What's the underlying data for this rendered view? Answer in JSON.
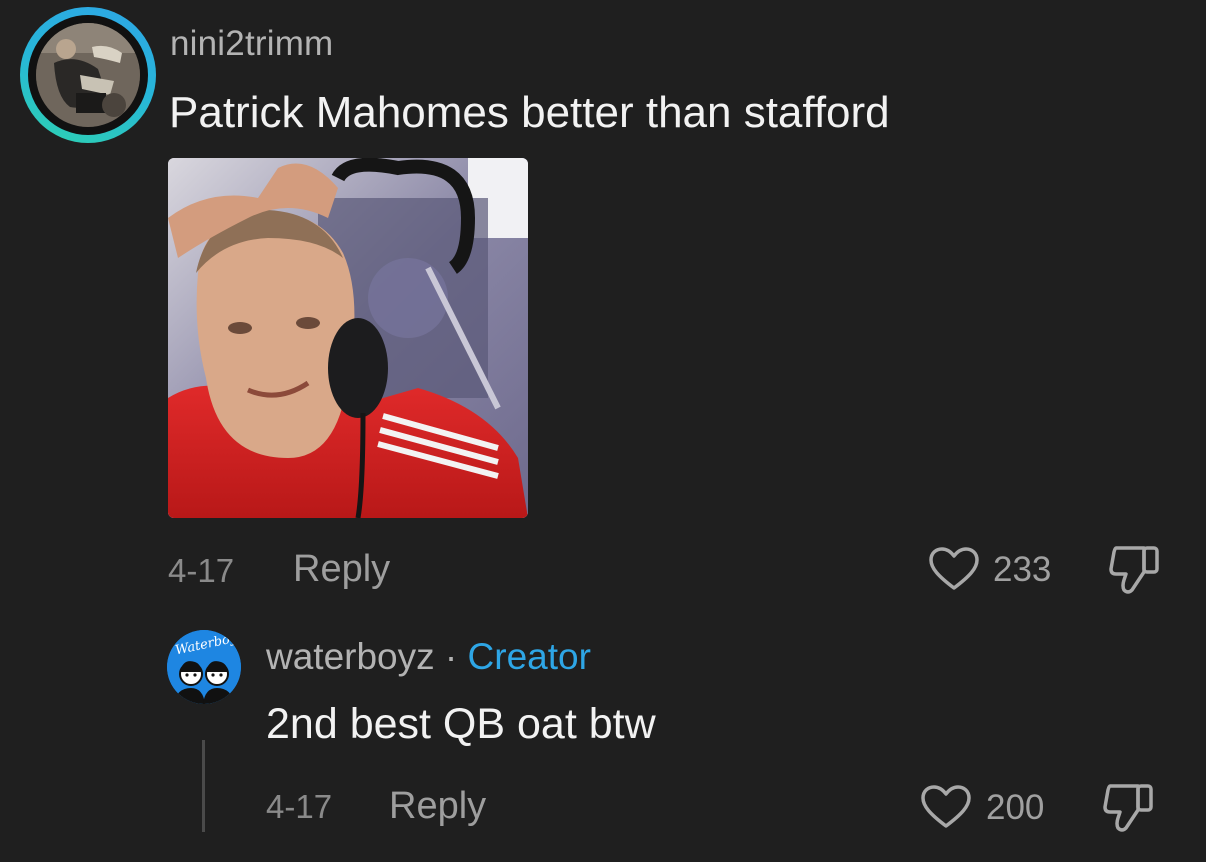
{
  "comment": {
    "username": "nini2trimm",
    "text": "Patrick Mahomes better than stafford",
    "date": "4-17",
    "reply_label": "Reply",
    "likes": "233"
  },
  "reply_comment": {
    "username": "waterboyz",
    "separator": "·",
    "creator_badge": "Creator",
    "text": "2nd best QB oat btw",
    "date": "4-17",
    "reply_label": "Reply",
    "likes": "200",
    "avatar_logo_text": "Waterboyz"
  },
  "icons": {
    "like": "heart-icon",
    "dislike": "thumbs-down-icon"
  },
  "colors": {
    "background": "#1f1f1f",
    "creator_accent": "#2ea6e6",
    "avatar_ring_start": "#2ea6e6",
    "avatar_ring_end": "#2ed2b0"
  }
}
